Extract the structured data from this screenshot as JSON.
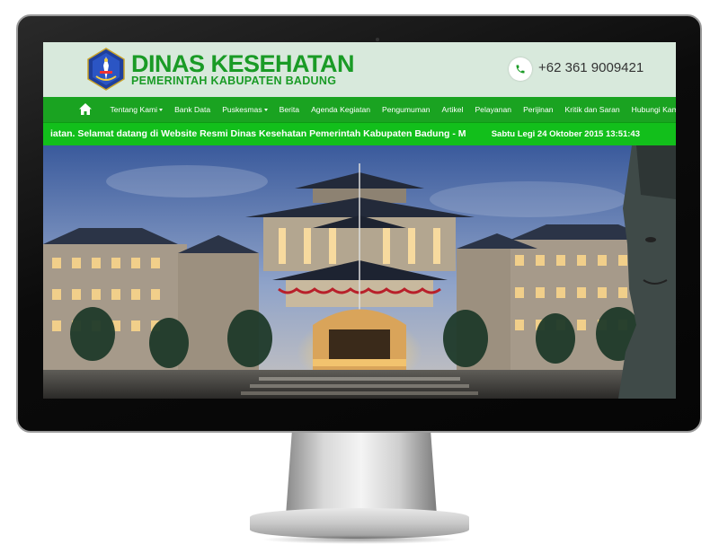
{
  "header": {
    "title": "DINAS KESEHATAN",
    "subtitle": "PEMERINTAH KABUPATEN BADUNG",
    "logo_icon": "badung-emblem-icon",
    "phone_icon": "phone-icon",
    "phone": "+62 361 9009421"
  },
  "nav": {
    "home_icon": "home-icon",
    "items": [
      {
        "label": "Tentang Kami",
        "dropdown": true
      },
      {
        "label": "Bank Data",
        "dropdown": false
      },
      {
        "label": "Puskesmas",
        "dropdown": true
      },
      {
        "label": "Berita",
        "dropdown": false
      },
      {
        "label": "Agenda Kegiatan",
        "dropdown": false
      },
      {
        "label": "Pengumuman",
        "dropdown": false
      },
      {
        "label": "Artikel",
        "dropdown": false
      },
      {
        "label": "Pelayanan",
        "dropdown": false
      },
      {
        "label": "Perijinan",
        "dropdown": false
      },
      {
        "label": "Kritik dan Saran",
        "dropdown": false
      },
      {
        "label": "Hubungi Kami",
        "dropdown": false
      }
    ]
  },
  "ticker": {
    "text": "iatan. Selamat datang di Website Resmi Dinas Kesehatan Pemerintah Kabupaten Badung - M",
    "datetime": "Sabtu Legi 24 Oktober 2015 13:51:43"
  },
  "colors": {
    "brand_green": "#1a9b26",
    "nav_green": "#1aa321",
    "ticker_green": "#12bf1b",
    "header_bg": "#d8e9dc"
  }
}
